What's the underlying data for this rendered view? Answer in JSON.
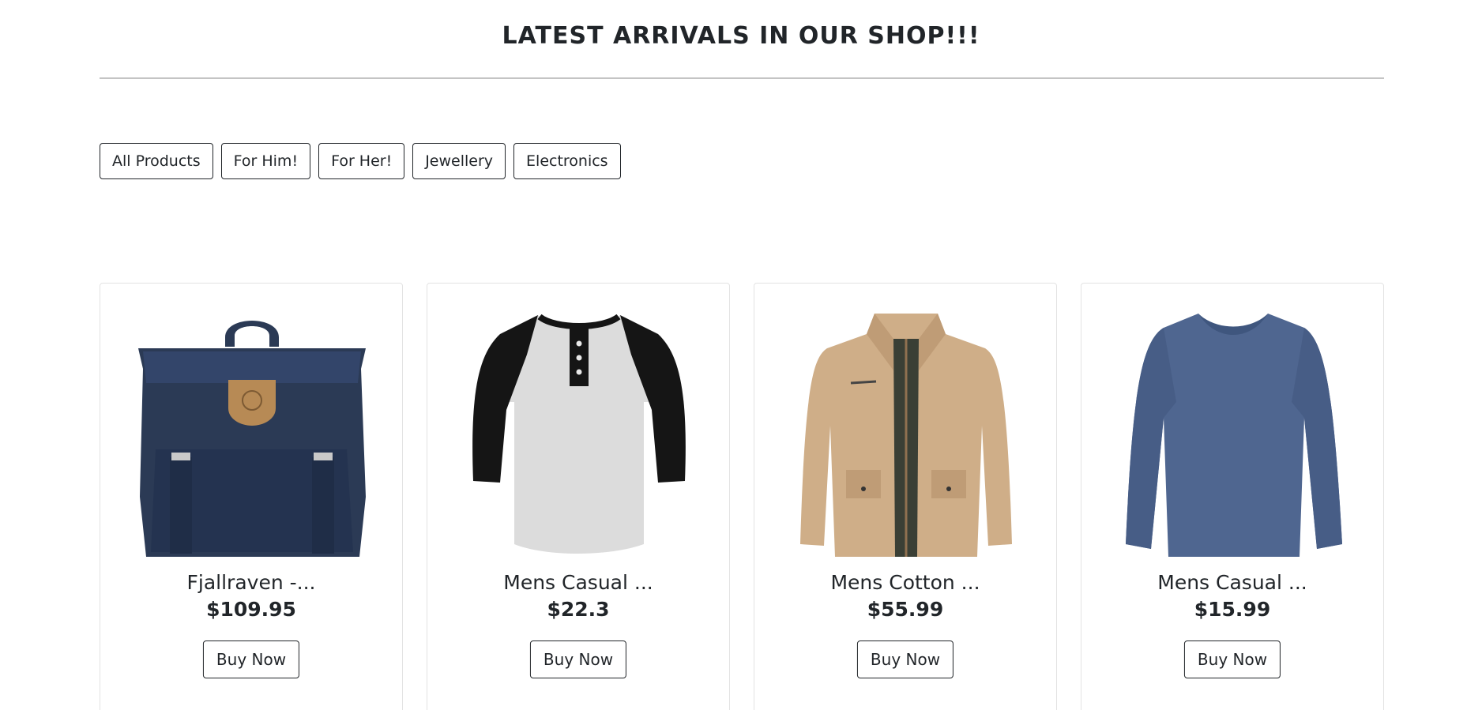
{
  "header": {
    "headline": "LATEST ARRIVALS IN OUR SHOP!!!"
  },
  "filters": [
    {
      "label": "All Products"
    },
    {
      "label": "For Him!"
    },
    {
      "label": "For Her!"
    },
    {
      "label": "Jewellery"
    },
    {
      "label": "Electronics"
    }
  ],
  "products": [
    {
      "title": "Fjallraven -...",
      "price": "$109.95",
      "button": "Buy Now",
      "image": "navy-backpack"
    },
    {
      "title": "Mens Casual ...",
      "price": "$22.3",
      "button": "Buy Now",
      "image": "raglan-henley-shirt"
    },
    {
      "title": "Mens Cotton ...",
      "price": "$55.99",
      "button": "Buy Now",
      "image": "khaki-cotton-jacket"
    },
    {
      "title": "Mens Casual ...",
      "price": "$15.99",
      "button": "Buy Now",
      "image": "blue-longsleeve-shirt"
    }
  ],
  "colors": {
    "text": "#212529",
    "rule": "#c4c4c4",
    "card_border": "#e3e3e3",
    "backpack": "#2b3a55",
    "backpack_patch": "#b78a55",
    "henley_body": "#dcdcdc",
    "henley_sleeve": "#151515",
    "jacket": "#cfae88",
    "jacket_lining": "#3a3f35",
    "longsleeve": "#4f6690"
  }
}
